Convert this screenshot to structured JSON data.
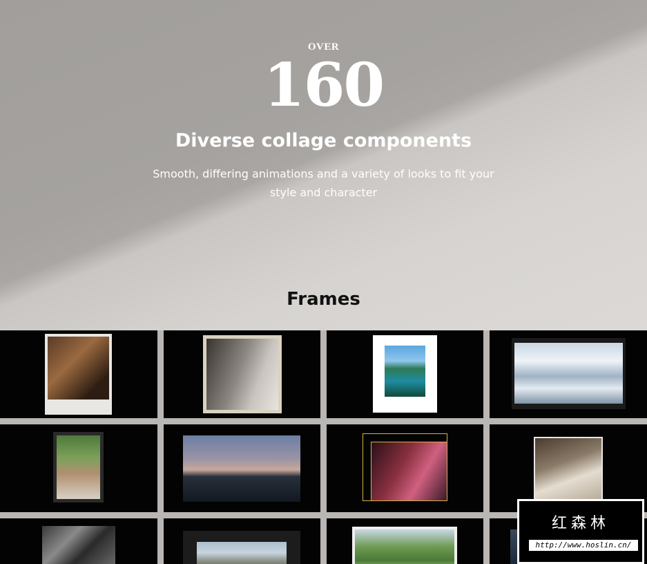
{
  "hero": {
    "over": "OVER",
    "count": "160",
    "heading": "Diverse collage components",
    "subtitle": "Smooth, differing animations and a variety of looks to fit your style and character"
  },
  "section": {
    "title": "Frames"
  },
  "watermark": {
    "brand": "红森林",
    "url": "http://www.hoslin.cn/"
  }
}
